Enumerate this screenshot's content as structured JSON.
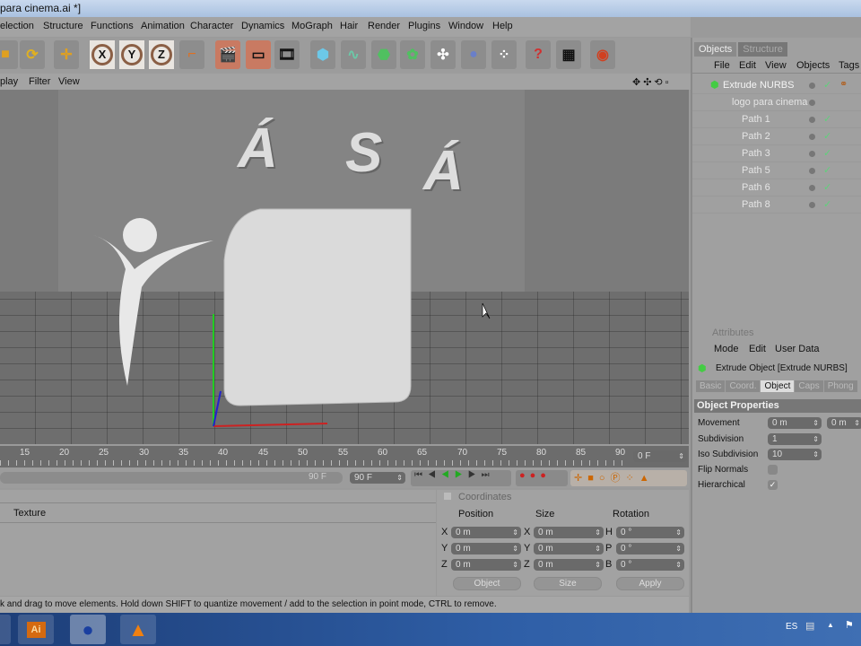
{
  "window": {
    "title": "para cinema.ai *]"
  },
  "menu": [
    "election",
    "Structure",
    "Functions",
    "Animation",
    "Character",
    "Dynamics",
    "MoGraph",
    "Hair",
    "Render",
    "Plugins",
    "Window",
    "Help"
  ],
  "toolbar": {
    "axis_x": "X",
    "axis_y": "Y",
    "axis_z": "Z"
  },
  "viewport_menu": [
    "play",
    "Filter",
    "View"
  ],
  "scene_text": [
    "Á",
    "S",
    "Á"
  ],
  "objects_panel": {
    "tabs": [
      "Objects",
      "Structure"
    ],
    "menu": [
      "File",
      "Edit",
      "View",
      "Objects",
      "Tags"
    ],
    "items": [
      {
        "name": "Extrude NURBS",
        "level": 0
      },
      {
        "name": "logo para cinema",
        "level": 1
      },
      {
        "name": "Path 1",
        "level": 2
      },
      {
        "name": "Path 2",
        "level": 2
      },
      {
        "name": "Path 3",
        "level": 2
      },
      {
        "name": "Path 5",
        "level": 2
      },
      {
        "name": "Path 6",
        "level": 2
      },
      {
        "name": "Path 8",
        "level": 2
      }
    ]
  },
  "attributes": {
    "title": "Attributes",
    "menu": [
      "Mode",
      "Edit",
      "User Data"
    ],
    "object_label": "Extrude Object [Extrude NURBS]",
    "tabs": [
      "Basic",
      "Coord.",
      "Object",
      "Caps",
      "Phong"
    ],
    "active_tab": "Object",
    "section": "Object Properties",
    "movement_label": "Movement",
    "movement_1": "0 m",
    "movement_2": "0 m",
    "subdivision_label": "Subdivision",
    "subdivision": "1",
    "iso_label": "Iso Subdivision",
    "iso": "10",
    "flip_label": "Flip Normals",
    "flip": false,
    "hier_label": "Hierarchical",
    "hier": true
  },
  "timeline": {
    "ticks": [
      "15",
      "20",
      "25",
      "30",
      "35",
      "40",
      "45",
      "50",
      "55",
      "60",
      "65",
      "70",
      "75",
      "80",
      "85",
      "90"
    ],
    "current_frame": "0 F",
    "end_frame": "90 F",
    "scroll_label": "90 F"
  },
  "material": {
    "texture_label": "Texture"
  },
  "coordinates": {
    "title": "Coordinates",
    "headers": [
      "Position",
      "Size",
      "Rotation"
    ],
    "rows": [
      {
        "a": "X",
        "p": "0 m",
        "b": "X",
        "s": "0 m",
        "c": "H",
        "r": "0 °"
      },
      {
        "a": "Y",
        "p": "0 m",
        "b": "Y",
        "s": "0 m",
        "c": "P",
        "r": "0 °"
      },
      {
        "a": "Z",
        "p": "0 m",
        "b": "Z",
        "s": "0 m",
        "c": "B",
        "r": "0 °"
      }
    ],
    "mode": "Object",
    "size_mode": "Size",
    "apply": "Apply"
  },
  "status": "k and drag to move elements. Hold down SHIFT to quantize movement / add to the selection in point mode, CTRL to remove.",
  "taskbar": {
    "ai_label": "Ai",
    "language": "ES"
  }
}
